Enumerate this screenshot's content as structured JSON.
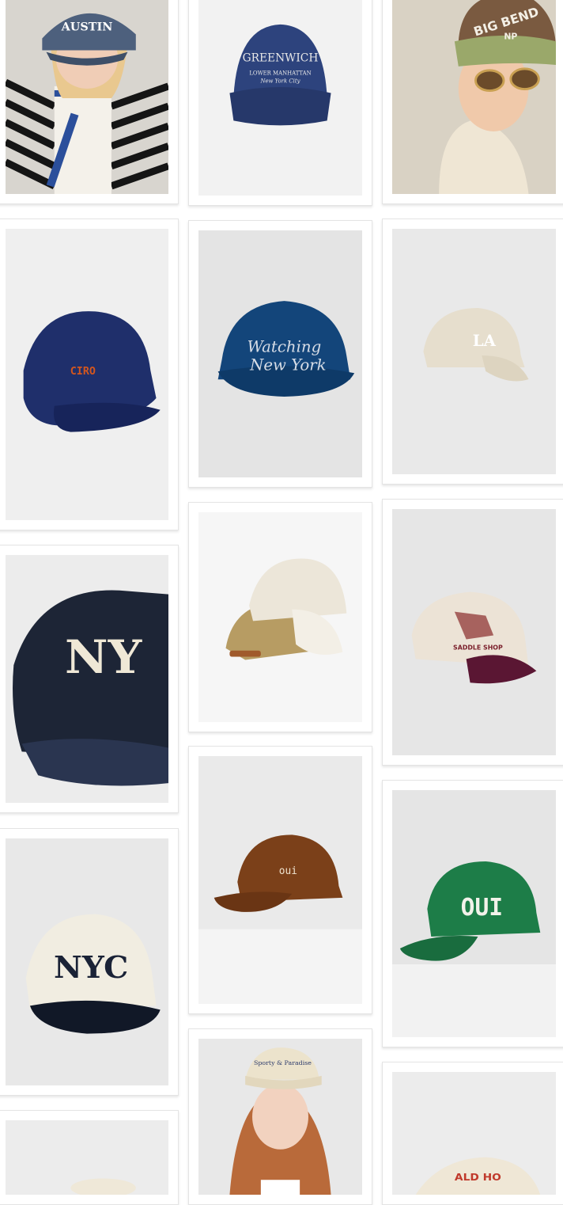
{
  "grid": {
    "items": [
      {
        "id": "austin-cap",
        "cap_text": "AUSTIN",
        "colors": {
          "cap": "#4d607d",
          "bg": "#d8d5cf"
        }
      },
      {
        "id": "greenwich-cap",
        "cap_text": "GREENWICH",
        "sub_text": "LOWER MANHATTAN",
        "sub_text2": "New York City",
        "colors": {
          "cap": "#2d437d",
          "bg": "#f2f2f2"
        }
      },
      {
        "id": "big-bend-cap",
        "cap_text": "BIG BEND",
        "sub_text": "NP",
        "colors": {
          "cap": "#7a5a40",
          "brim": "#9aa86a",
          "bg": "#d9d2c4"
        }
      },
      {
        "id": "ciro-cap",
        "cap_text": "CIRO",
        "colors": {
          "cap": "#1f2f6b",
          "bg": "#efefef"
        }
      },
      {
        "id": "watching-new-york-cap",
        "cap_text": "Watching",
        "sub_text": "New York",
        "colors": {
          "cap": "#13457a",
          "bg": "#e4e4e4"
        }
      },
      {
        "id": "la-cap",
        "cap_text": "LA",
        "colors": {
          "cap": "#e6decd",
          "bg": "#e9e9e9"
        }
      },
      {
        "id": "ny-cap",
        "cap_text": "NY",
        "colors": {
          "cap": "#1d2536",
          "bg": "#ececec"
        }
      },
      {
        "id": "stacked-caps",
        "cap_text": "",
        "colors": {
          "cap": "#ece6d9",
          "cap2": "#b79c63",
          "bg": "#f6f6f6"
        }
      },
      {
        "id": "saddle-shop-cap",
        "cap_text": "SADDLE SHOP",
        "colors": {
          "cap": "#ece3d6",
          "brim": "#5a1633",
          "bg": "#e6e6e6"
        }
      },
      {
        "id": "nyc-cap",
        "cap_text": "NYC",
        "colors": {
          "cap": "#f1ede1",
          "brim": "#111827",
          "bg": "#e8e8e8"
        }
      },
      {
        "id": "oui-brown-cap",
        "cap_text": "oui",
        "colors": {
          "cap": "#7b4019",
          "bg": "#eaeaea"
        }
      },
      {
        "id": "oui-green-cap",
        "cap_text": "OUI",
        "colors": {
          "cap": "#1d7d48",
          "bg": "#e5e5e5"
        }
      },
      {
        "id": "model-beige-cap",
        "cap_text": "Sporty & Paradise",
        "colors": {
          "cap": "#ece3cc",
          "bg": "#e8e8e8"
        }
      },
      {
        "id": "partial-cap-left",
        "cap_text": "",
        "colors": {
          "cap": "#efe8d8",
          "bg": "#ececec"
        }
      },
      {
        "id": "partial-cap-right",
        "cap_text": "ALD HO",
        "colors": {
          "cap": "#efe7d6",
          "bg": "#ececec"
        }
      }
    ]
  }
}
